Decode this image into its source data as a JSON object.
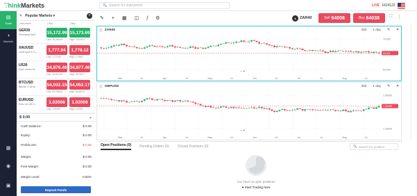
{
  "brand": {
    "name_prefix": "Think",
    "name_suffix": "Markets"
  },
  "search": {
    "placeholder": "Search for instrument"
  },
  "account_top": {
    "live_label": "LIVE",
    "account_id": "1624122"
  },
  "nav": [
    {
      "label": "Trade",
      "icon": "trade-icon"
    },
    {
      "label": "Markets",
      "icon": "markets-icon"
    }
  ],
  "watchlist": {
    "title": "Popular Markets",
    "col_instrument": "Instrument",
    "col_sell": "| Sell",
    "col_buy": "| Buy",
    "rows": [
      {
        "symbol": "GER30",
        "desc": "Germany DAX",
        "sell": "15,172.99",
        "buy": "15,173.69",
        "low": "Low: 15,053.09",
        "high": "High: 15,192.6",
        "color": "green"
      },
      {
        "symbol": "XAUUSD",
        "desc": "Gold spot in U...",
        "sell": "1,777.94",
        "buy": "1,778.12",
        "low": "Low: 1,772.81",
        "high": "High: 1,788.0",
        "color": "red"
      },
      {
        "symbol": "US30",
        "desc": "Dow Jones In...",
        "sell": "34,876.46",
        "buy": "34,877.46",
        "low": "Low: 34,812.54",
        "high": "High: 35,015.7",
        "color": "red"
      },
      {
        "symbol": "BTCUSD",
        "desc": "Bitcoin 1 bit w...",
        "sell": "54,032.15",
        "buy": "54,052.17",
        "low": "Low: 53,765.81",
        "high": "High: 54,891.9",
        "color": "red"
      },
      {
        "symbol": "EURUSD",
        "desc": "Euro vs US D...",
        "sell": "1.02008",
        "buy": "1.02008",
        "low": "Low: 1.01871",
        "high": "High: 1.0229",
        "color": "red"
      }
    ]
  },
  "account": {
    "balance_display": "$ 0.00",
    "rows": [
      {
        "label": "Cash Balance:",
        "value": "$ 0.00",
        "red": false
      },
      {
        "label": "Equity:",
        "value": "$ 0.00",
        "red": false
      },
      {
        "label": "Profit/Loss:",
        "value": "$ 0.00",
        "red": true
      },
      {
        "label": "Margin:",
        "value": "$ 0.00",
        "red": false
      },
      {
        "label": "Free Margin:",
        "value": "$ 0.00",
        "red": false
      },
      {
        "label": "Margin Level:",
        "value": "0.00%",
        "red": false
      }
    ],
    "deposit_label": "Deposit Funds"
  },
  "toolbar": {
    "symbol": "ZAR40",
    "sell_label": "Sell",
    "sell_price": "64008",
    "buy_label": "Buy",
    "buy_price": "64038"
  },
  "charts": [
    {
      "name": "ZAR40",
      "bid": "Bid",
      "interval": "1 day",
      "ylabels": [
        "70,000",
        "65,000",
        "60,000"
      ],
      "xlabels": [
        "Mar",
        "14",
        "Apr",
        "14",
        "May",
        "14",
        "Jun",
        "14",
        "Jul",
        "14",
        "Aug",
        "14"
      ],
      "price_tag": "64,011"
    },
    {
      "name": "GBPUSD",
      "bid": "Bid",
      "interval": "1 day",
      "ylabels": [
        "1.30000",
        "1.20000"
      ],
      "xlabels": [
        "Mar",
        "14",
        "Apr",
        "14",
        "May",
        "14",
        "Jun",
        "14",
        "Jul",
        "14",
        "Aug",
        "14"
      ],
      "price_tag": "1.20968"
    }
  ],
  "positions": {
    "tabs": [
      "Open Positions (0)",
      "Pending Orders (0)",
      "Closed Positions (0)"
    ],
    "search_placeholder": "Search for position",
    "empty_text": "You have no open positions",
    "start_label": "Start Trading Now"
  }
}
